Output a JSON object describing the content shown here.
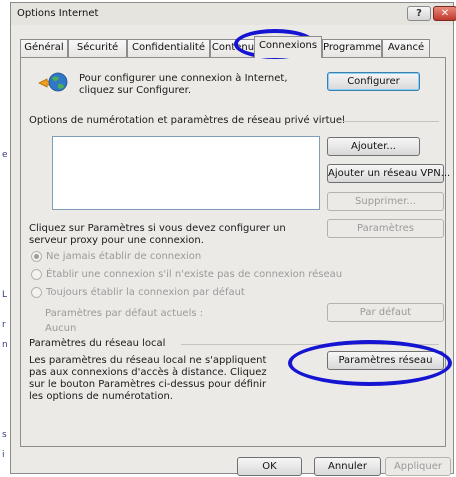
{
  "window": {
    "title": "Options Internet",
    "help_label": "?",
    "close_label": "✕"
  },
  "tabs": [
    {
      "label": "Général"
    },
    {
      "label": "Sécurité"
    },
    {
      "label": "Confidentialité"
    },
    {
      "label": "Contenu"
    },
    {
      "label": "Connexions"
    },
    {
      "label": "Programmes"
    },
    {
      "label": "Avancé"
    }
  ],
  "setup": {
    "icon": "globe-network-icon",
    "text": "Pour configurer une connexion à Internet, cliquez sur Configurer.",
    "button": "Configurer"
  },
  "dialup": {
    "heading": "Options de numérotation et paramètres de réseau privé virtuel",
    "add_button": "Ajouter...",
    "add_vpn_button": "Ajouter un réseau VPN...",
    "remove_button": "Supprimer...",
    "settings_button": "Paramètres",
    "proxy_text": "Cliquez sur Paramètres si vous devez configurer un serveur proxy pour une connexion.",
    "options": [
      {
        "label": "Ne jamais établir de connexion",
        "selected": true
      },
      {
        "label": "Établir une connexion s'il n'existe pas de connexion réseau",
        "selected": false
      },
      {
        "label": "Toujours établir la connexion par défaut",
        "selected": false
      }
    ],
    "default_label": "Paramètres par défaut actuels :",
    "default_value": "Aucun",
    "default_button": "Par défaut"
  },
  "lan": {
    "heading": "Paramètres du réseau local",
    "text": "Les paramètres du réseau local ne s'appliquent pas aux connexions d'accès à distance. Cliquez sur le bouton Paramètres ci-dessus pour définir les options de numérotation.",
    "button": "Paramètres réseau"
  },
  "footer": {
    "ok": "OK",
    "cancel": "Annuler",
    "apply": "Appliquer"
  },
  "annotations": {
    "color": "#1414d2"
  }
}
